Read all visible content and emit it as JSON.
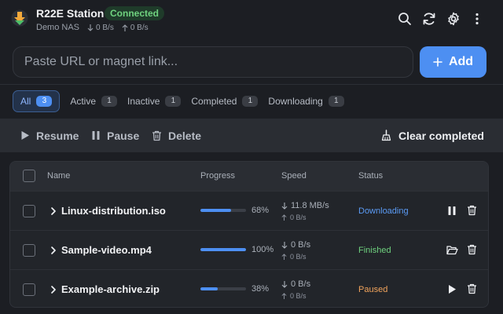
{
  "app": {
    "title": "R22E Station",
    "status_badge": "Connected",
    "device": "Demo NAS",
    "download_speed": "0 B/s",
    "upload_speed": "0 B/s"
  },
  "header_icons": [
    "search-icon",
    "refresh-icon",
    "gear-icon",
    "more-vertical-icon"
  ],
  "add_bar": {
    "placeholder": "Paste URL or magnet link...",
    "add_label": "Add"
  },
  "filters": [
    {
      "label": "All",
      "count": "3"
    },
    {
      "label": "Active",
      "count": "1"
    },
    {
      "label": "Inactive",
      "count": "1"
    },
    {
      "label": "Completed",
      "count": "1"
    },
    {
      "label": "Downloading",
      "count": "1"
    }
  ],
  "actions": {
    "resume": "Resume",
    "pause": "Pause",
    "delete": "Delete",
    "clear_completed": "Clear completed"
  },
  "table": {
    "headers": {
      "name": "Name",
      "progress": "Progress",
      "speed": "Speed",
      "status": "Status"
    },
    "rows": [
      {
        "name": "Linux-distribution.iso",
        "progress": 0.68,
        "progress_label": "68%",
        "down": "11.8 MB/s",
        "up": "0 B/s",
        "status": "Downloading",
        "status_color": "#5b9bf5",
        "primary_action": "pause-icon"
      },
      {
        "name": "Sample-video.mp4",
        "progress": 1.0,
        "progress_label": "100%",
        "down": "0 B/s",
        "up": "0 B/s",
        "status": "Finished",
        "status_color": "#6fd27f",
        "primary_action": "folder-open-icon"
      },
      {
        "name": "Example-archive.zip",
        "progress": 0.38,
        "progress_label": "38%",
        "down": "0 B/s",
        "up": "0 B/s",
        "status": "Paused",
        "status_color": "#f0a35c",
        "primary_action": "play-icon"
      }
    ]
  },
  "colors": {
    "accent": "#4d8ff2",
    "background": "#1c1e23",
    "connected": "#6fd27f"
  }
}
